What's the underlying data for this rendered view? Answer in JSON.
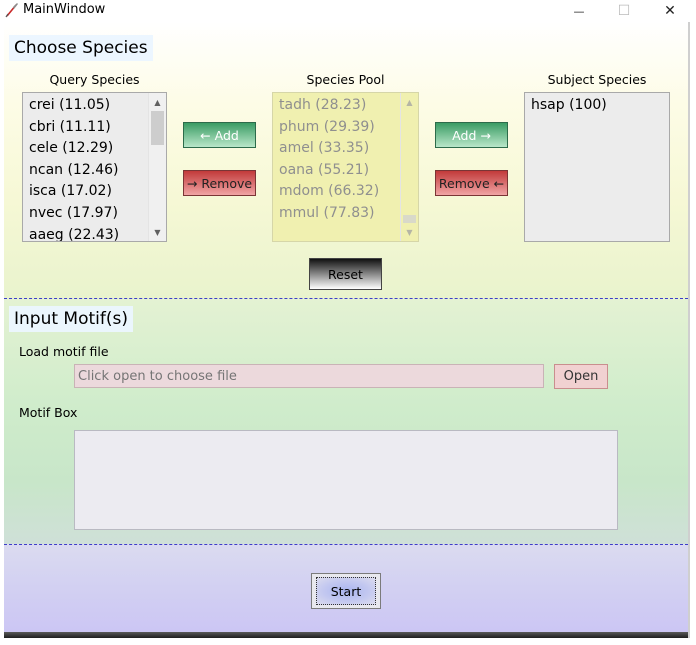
{
  "window": {
    "title": "MainWindow",
    "minimize_glyph": "—",
    "maximize_glyph": "☐",
    "close_glyph": "✕"
  },
  "species": {
    "header": "Choose Species",
    "query": {
      "label": "Query Species",
      "items": [
        "crei (11.05)",
        "cbri (11.11)",
        "cele (12.29)",
        "ncan (12.46)",
        "isca (17.02)",
        "nvec (17.97)",
        "aaeg (22.43)"
      ]
    },
    "pool": {
      "label": "Species Pool",
      "items": [
        "tadh (28.23)",
        "phum (29.39)",
        "amel (33.35)",
        "oana (55.21)",
        "mdom (66.32)",
        "mmul (77.83)"
      ]
    },
    "subject": {
      "label": "Subject Species",
      "items": [
        "hsap (100)"
      ]
    },
    "buttons": {
      "add_left": "← Add",
      "remove_left": "→ Remove",
      "add_right": "Add →",
      "remove_right": "Remove ←",
      "reset": "Reset"
    }
  },
  "motif": {
    "header": "Input Motif(s)",
    "load_label": "Load motif file",
    "file_placeholder": "Click open to choose file",
    "open_label": "Open",
    "box_label": "Motif Box",
    "box_value": ""
  },
  "start": {
    "label": "Start"
  },
  "colors": {
    "add_button": "#3a9c64",
    "remove_button": "#c23a3a",
    "divider": "#3d3dc8",
    "pool_background": "#f0f0b0"
  },
  "icons": {
    "app": "feather-pen-icon",
    "scroll_up": "chevron-up-icon",
    "scroll_down": "chevron-down-icon"
  }
}
